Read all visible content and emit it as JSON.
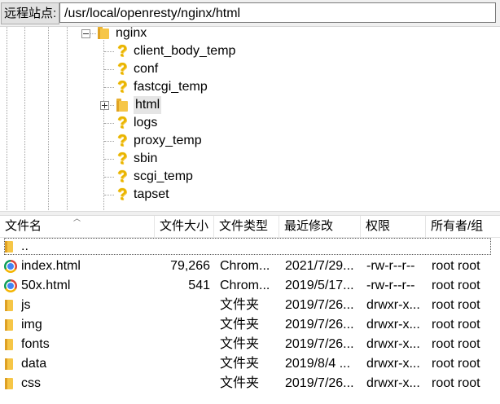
{
  "address": {
    "label": "远程站点:",
    "path": "/usr/local/openresty/nginx/html"
  },
  "tree": {
    "root": "nginx",
    "children": [
      {
        "name": "client_body_temp",
        "icon": "unknown-folder-icon"
      },
      {
        "name": "conf",
        "icon": "unknown-folder-icon"
      },
      {
        "name": "fastcgi_temp",
        "icon": "unknown-folder-icon"
      },
      {
        "name": "html",
        "icon": "folder-icon",
        "selected": true
      },
      {
        "name": "logs",
        "icon": "unknown-folder-icon"
      },
      {
        "name": "proxy_temp",
        "icon": "unknown-folder-icon"
      },
      {
        "name": "sbin",
        "icon": "unknown-folder-icon"
      },
      {
        "name": "scgi_temp",
        "icon": "unknown-folder-icon"
      },
      {
        "name": "tapset",
        "icon": "unknown-folder-icon"
      }
    ]
  },
  "list": {
    "columns": [
      "文件名",
      "文件大小",
      "文件类型",
      "最近修改",
      "权限",
      "所有者/组"
    ],
    "rows": [
      {
        "name": "..",
        "size": "",
        "type": "",
        "modified": "",
        "perm": "",
        "owner": "",
        "icon": "folder-icon"
      },
      {
        "name": "index.html",
        "size": "79,266",
        "type": "Chrom...",
        "modified": "2021/7/29...",
        "perm": "-rw-r--r--",
        "owner": "root root",
        "icon": "chrome-icon"
      },
      {
        "name": "50x.html",
        "size": "541",
        "type": "Chrom...",
        "modified": "2019/5/17...",
        "perm": "-rw-r--r--",
        "owner": "root root",
        "icon": "chrome-icon"
      },
      {
        "name": "js",
        "size": "",
        "type": "文件夹",
        "modified": "2019/7/26...",
        "perm": "drwxr-x...",
        "owner": "root root",
        "icon": "folder-icon"
      },
      {
        "name": "img",
        "size": "",
        "type": "文件夹",
        "modified": "2019/7/26...",
        "perm": "drwxr-x...",
        "owner": "root root",
        "icon": "folder-icon"
      },
      {
        "name": "fonts",
        "size": "",
        "type": "文件夹",
        "modified": "2019/7/26...",
        "perm": "drwxr-x...",
        "owner": "root root",
        "icon": "folder-icon"
      },
      {
        "name": "data",
        "size": "",
        "type": "文件夹",
        "modified": "2019/8/4 ...",
        "perm": "drwxr-x...",
        "owner": "root root",
        "icon": "folder-icon"
      },
      {
        "name": "css",
        "size": "",
        "type": "文件夹",
        "modified": "2019/7/26...",
        "perm": "drwxr-x...",
        "owner": "root root",
        "icon": "folder-icon"
      }
    ]
  }
}
